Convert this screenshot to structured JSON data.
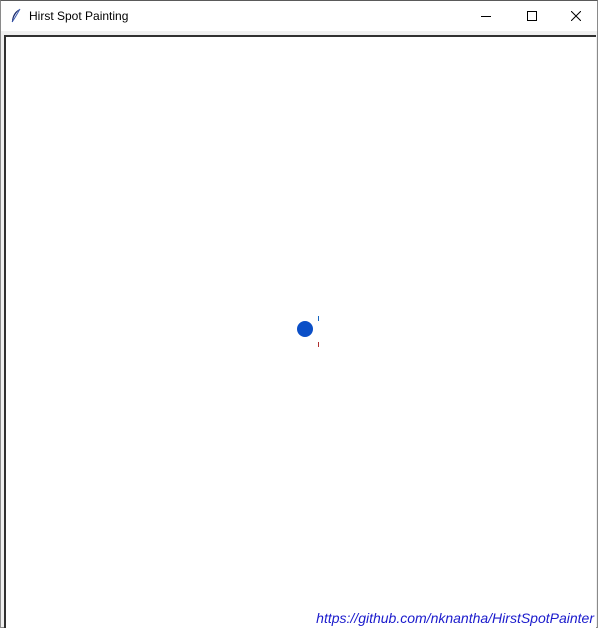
{
  "window": {
    "title": "Hirst Spot Painting",
    "icon": "feather-icon"
  },
  "controls": {
    "minimize_icon": "minimize-icon",
    "maximize_icon": "maximize-icon",
    "close_icon": "close-icon"
  },
  "canvas": {
    "background": "#ffffff",
    "spot_color": "#0b4fc7",
    "tick_top_color": "#1565c0",
    "tick_bottom_color": "#b03030",
    "footer_link": "https://github.com/nknantha/HirstSpotPainter",
    "footer_color": "#1a1acc"
  }
}
